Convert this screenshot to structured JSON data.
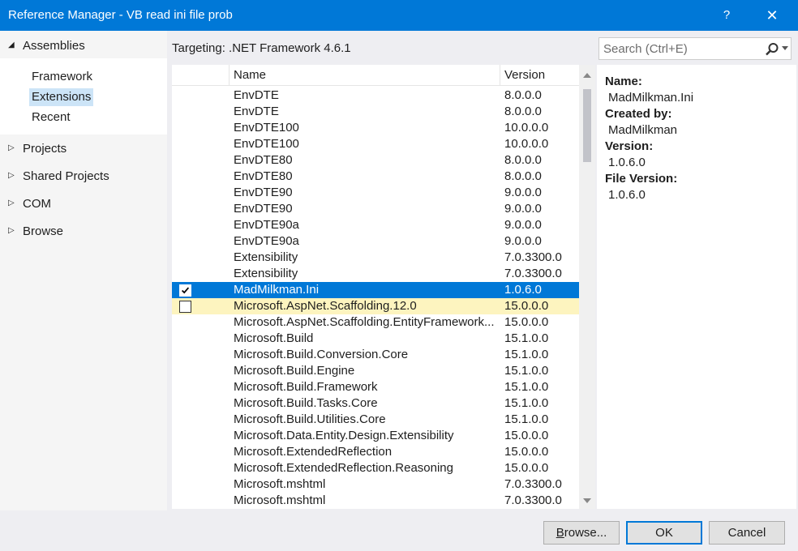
{
  "window": {
    "title": "Reference Manager - VB read ini file prob",
    "help_glyph": "?",
    "close_glyph": "✕"
  },
  "sidebar": {
    "groups": [
      {
        "label": "Assemblies",
        "expanded": true,
        "arrow": "◢"
      },
      {
        "label": "Projects",
        "expanded": false,
        "arrow": "▷"
      },
      {
        "label": "Shared Projects",
        "expanded": false,
        "arrow": "▷"
      },
      {
        "label": "COM",
        "expanded": false,
        "arrow": "▷"
      },
      {
        "label": "Browse",
        "expanded": false,
        "arrow": "▷"
      }
    ],
    "assemblies_items": [
      "Framework",
      "Extensions",
      "Recent"
    ],
    "selected_item": "Extensions"
  },
  "targeting": "Targeting: .NET Framework 4.6.1",
  "search": {
    "placeholder": "Search (Ctrl+E)",
    "icon": "search-icon"
  },
  "table": {
    "columns": [
      "Name",
      "Version"
    ],
    "rows": [
      {
        "name": "EnvDTE",
        "version": "8.0.0.0",
        "checked": false,
        "state": ""
      },
      {
        "name": "EnvDTE",
        "version": "8.0.0.0",
        "checked": false,
        "state": ""
      },
      {
        "name": "EnvDTE100",
        "version": "10.0.0.0",
        "checked": false,
        "state": ""
      },
      {
        "name": "EnvDTE100",
        "version": "10.0.0.0",
        "checked": false,
        "state": ""
      },
      {
        "name": "EnvDTE80",
        "version": "8.0.0.0",
        "checked": false,
        "state": ""
      },
      {
        "name": "EnvDTE80",
        "version": "8.0.0.0",
        "checked": false,
        "state": ""
      },
      {
        "name": "EnvDTE90",
        "version": "9.0.0.0",
        "checked": false,
        "state": ""
      },
      {
        "name": "EnvDTE90",
        "version": "9.0.0.0",
        "checked": false,
        "state": ""
      },
      {
        "name": "EnvDTE90a",
        "version": "9.0.0.0",
        "checked": false,
        "state": ""
      },
      {
        "name": "EnvDTE90a",
        "version": "9.0.0.0",
        "checked": false,
        "state": ""
      },
      {
        "name": "Extensibility",
        "version": "7.0.3300.0",
        "checked": false,
        "state": ""
      },
      {
        "name": "Extensibility",
        "version": "7.0.3300.0",
        "checked": false,
        "state": ""
      },
      {
        "name": "MadMilkman.Ini",
        "version": "1.0.6.0",
        "checked": true,
        "state": "selected"
      },
      {
        "name": "Microsoft.AspNet.Scaffolding.12.0",
        "version": "15.0.0.0",
        "checked": false,
        "state": "hover",
        "show_box": true
      },
      {
        "name": "Microsoft.AspNet.Scaffolding.EntityFramework...",
        "version": "15.0.0.0",
        "checked": false,
        "state": ""
      },
      {
        "name": "Microsoft.Build",
        "version": "15.1.0.0",
        "checked": false,
        "state": ""
      },
      {
        "name": "Microsoft.Build.Conversion.Core",
        "version": "15.1.0.0",
        "checked": false,
        "state": ""
      },
      {
        "name": "Microsoft.Build.Engine",
        "version": "15.1.0.0",
        "checked": false,
        "state": ""
      },
      {
        "name": "Microsoft.Build.Framework",
        "version": "15.1.0.0",
        "checked": false,
        "state": ""
      },
      {
        "name": "Microsoft.Build.Tasks.Core",
        "version": "15.1.0.0",
        "checked": false,
        "state": ""
      },
      {
        "name": "Microsoft.Build.Utilities.Core",
        "version": "15.1.0.0",
        "checked": false,
        "state": ""
      },
      {
        "name": "Microsoft.Data.Entity.Design.Extensibility",
        "version": "15.0.0.0",
        "checked": false,
        "state": ""
      },
      {
        "name": "Microsoft.ExtendedReflection",
        "version": "15.0.0.0",
        "checked": false,
        "state": ""
      },
      {
        "name": "Microsoft.ExtendedReflection.Reasoning",
        "version": "15.0.0.0",
        "checked": false,
        "state": ""
      },
      {
        "name": "Microsoft.mshtml",
        "version": "7.0.3300.0",
        "checked": false,
        "state": ""
      },
      {
        "name": "Microsoft.mshtml",
        "version": "7.0.3300.0",
        "checked": false,
        "state": ""
      }
    ]
  },
  "details": {
    "name_label": "Name:",
    "name_value": "MadMilkman.Ini",
    "created_label": "Created by:",
    "created_value": "MadMilkman",
    "version_label": "Version:",
    "version_value": "1.0.6.0",
    "file_version_label": "File Version:",
    "file_version_value": "1.0.6.0"
  },
  "buttons": {
    "browse": "Browse...",
    "ok": "OK",
    "cancel": "Cancel"
  },
  "colors": {
    "accent": "#0078d7",
    "hover_row": "#fdf4bf",
    "selected_nav": "#cce4f7"
  }
}
